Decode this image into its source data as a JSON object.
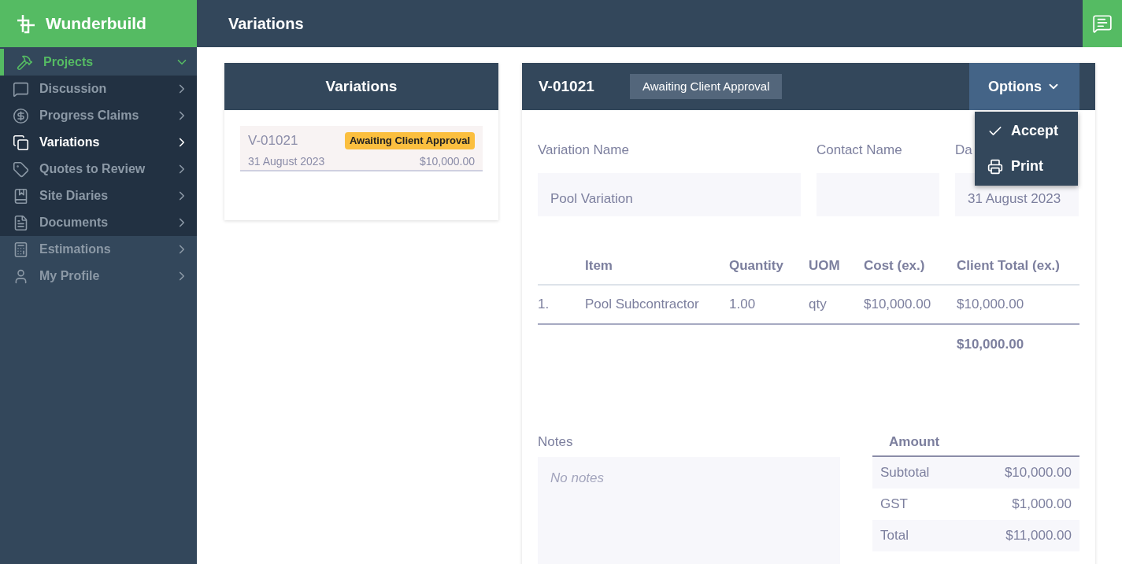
{
  "app": {
    "name": "Wunderbuild"
  },
  "header": {
    "title": "Variations"
  },
  "sidebar": {
    "items": [
      {
        "label": "Projects",
        "selected": false,
        "expanded": true,
        "children": [
          {
            "label": "Discussion",
            "selected": false
          },
          {
            "label": "Progress Claims",
            "selected": false
          },
          {
            "label": "Variations",
            "selected": true
          },
          {
            "label": "Quotes to Review",
            "selected": false
          },
          {
            "label": "Site Diaries",
            "selected": false
          },
          {
            "label": "Documents",
            "selected": false
          }
        ]
      },
      {
        "label": "Estimations",
        "selected": false,
        "expanded": false
      },
      {
        "label": "My Profile",
        "selected": false,
        "expanded": false
      }
    ]
  },
  "list_panel": {
    "title": "Variations",
    "items": [
      {
        "code": "V-01021",
        "status": "Awaiting Client Approval",
        "date": "31 August 2023",
        "amount": "$10,000.00",
        "selected": true
      }
    ]
  },
  "detail": {
    "code": "V-01021",
    "status": "Awaiting Client Approval",
    "options": {
      "label": "Options",
      "expanded": true,
      "items": [
        {
          "kind": "check",
          "label": "Accept"
        },
        {
          "kind": "print",
          "label": "Print"
        }
      ]
    },
    "fields": [
      {
        "label": "Variation Name",
        "value": "Pool Variation"
      },
      {
        "label": "Contact Name"
      },
      {
        "label": "Da",
        "value": "31 August 2023"
      }
    ],
    "table": {
      "columns": [
        "Item",
        "Quantity",
        "UOM",
        "Cost (ex.)",
        "Client Total (ex.)"
      ],
      "rows": [
        {
          "number": "1.",
          "cells": [
            "Pool Subcontractor",
            "1.00",
            "qty",
            "$10,000.00",
            "$10,000.00"
          ]
        }
      ],
      "total": "$10,000.00"
    },
    "notes": {
      "label": "Notes",
      "placeholder": "No notes"
    },
    "amount": {
      "title": "Amount",
      "rows": [
        {
          "label": "Subtotal",
          "value": "$10,000.00"
        },
        {
          "label": "GST",
          "value": "$1,000.00"
        },
        {
          "label": "Total",
          "value": "$11,000.00"
        }
      ]
    }
  }
}
